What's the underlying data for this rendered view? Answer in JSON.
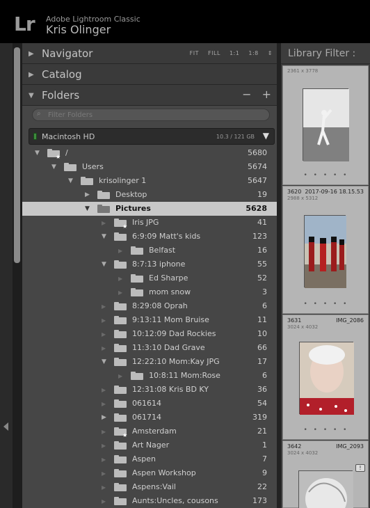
{
  "identity": {
    "logo": "Lr",
    "app_name": "Adobe Lightroom Classic",
    "user_name": "Kris Olinger"
  },
  "panels": {
    "navigator": {
      "title": "Navigator",
      "options": [
        "FIT",
        "FILL",
        "1:1",
        "1:8"
      ]
    },
    "catalog": {
      "title": "Catalog"
    },
    "folders": {
      "title": "Folders",
      "minus": "−",
      "plus": "+"
    }
  },
  "search": {
    "placeholder": "Filter Folders"
  },
  "volume": {
    "name": "Macintosh HD",
    "size": "10.3 / 121 GB"
  },
  "folders": [
    {
      "label": "/",
      "count": "5680",
      "expanded": true,
      "star": true
    },
    {
      "label": "Users",
      "count": "5674",
      "expanded": true
    },
    {
      "label": "krisolinger 1",
      "count": "5647",
      "expanded": true
    },
    {
      "label": "Desktop",
      "count": "19",
      "expanded": false
    },
    {
      "label": "Pictures",
      "count": "5628",
      "expanded": true,
      "selected": true
    },
    {
      "label": "Iris JPG",
      "count": "41",
      "star": true
    },
    {
      "label": "6:9:09  Matt's kids",
      "count": "123",
      "expanded": true
    },
    {
      "label": "Belfast",
      "count": "16"
    },
    {
      "label": "8:7:13 iphone",
      "count": "55",
      "expanded": true
    },
    {
      "label": "Ed Sharpe",
      "count": "52"
    },
    {
      "label": "mom snow",
      "count": "3"
    },
    {
      "label": "8:29:08  Oprah",
      "count": "6"
    },
    {
      "label": "9:13:11 Mom Bruise",
      "count": "11"
    },
    {
      "label": "10:12:09  Dad Rockies",
      "count": "10"
    },
    {
      "label": "11:3:10  Dad Grave",
      "count": "66"
    },
    {
      "label": "12:22:10 Mom:Kay JPG",
      "count": "17",
      "expanded": true
    },
    {
      "label": "10:8:11  Mom:Rose",
      "count": "6"
    },
    {
      "label": "12:31:08  Kris BD KY",
      "count": "36"
    },
    {
      "label": "061614",
      "count": "54"
    },
    {
      "label": "061714",
      "count": "319",
      "expanded": false
    },
    {
      "label": "Amsterdam",
      "count": "21",
      "star": true
    },
    {
      "label": "Art Nager",
      "count": "1"
    },
    {
      "label": "Aspen",
      "count": "7"
    },
    {
      "label": "Aspen Workshop",
      "count": "9"
    },
    {
      "label": "Aspens:Vail",
      "count": "22"
    },
    {
      "label": "Aunts:Uncles, cousons",
      "count": "173"
    }
  ],
  "library": {
    "filter_label": "Library Filter :",
    "cells": [
      {
        "dim": "2361 x 3778",
        "dots": "• • • • •"
      },
      {
        "index": "3620",
        "date": "2017-09-16 18.15.53",
        "dim": "2988 x 5312",
        "dots": "• • • • •"
      },
      {
        "index": "3631",
        "date": "IMG_2086",
        "dim": "3024 x 4032",
        "dots": "• • • • •"
      },
      {
        "index": "3642",
        "date": "IMG_2093",
        "dim": "3024 x 4032",
        "badge": "!"
      }
    ]
  },
  "colors": {
    "panel_bg": "#464646",
    "selection": "#c8c8c8",
    "volume_led": "#3d8b3d"
  }
}
